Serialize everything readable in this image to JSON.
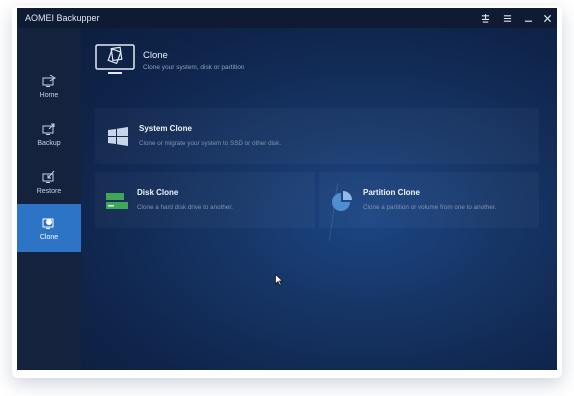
{
  "window": {
    "title": "AOMEI Backupper",
    "controls": {
      "menu": "menu-icon",
      "list": "list-icon",
      "minimize": "minimize-icon",
      "close": "close-icon"
    }
  },
  "sidebar": {
    "items": [
      {
        "label": "Home",
        "icon": "home-icon",
        "active": false
      },
      {
        "label": "Backup",
        "icon": "backup-icon",
        "active": false
      },
      {
        "label": "Restore",
        "icon": "restore-icon",
        "active": false
      },
      {
        "label": "Clone",
        "icon": "clone-icon",
        "active": true
      }
    ]
  },
  "header": {
    "title": "Clone",
    "subtitle": "Clone your system, disk or partition"
  },
  "options": {
    "system": {
      "title": "System Clone",
      "desc": "Clone or migrate your system to SSD or other disk."
    },
    "disk": {
      "title": "Disk Clone",
      "desc": "Clone a hard disk drive to another."
    },
    "partition": {
      "title": "Partition Clone",
      "desc": "Clone a partition or volume from one to another."
    }
  },
  "colors": {
    "accent": "#2e74c6",
    "sidebar": "#15223d",
    "titlebar": "#0e1b33",
    "disk_green": "#3fa65a",
    "partition_blue": "#4f8fd0"
  }
}
